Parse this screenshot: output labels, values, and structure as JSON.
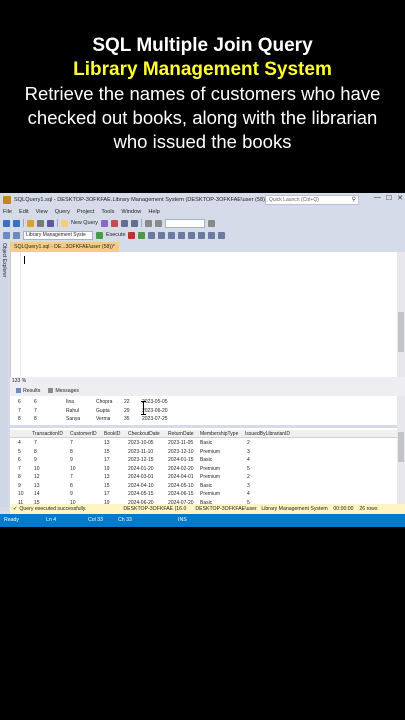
{
  "caption": {
    "title": "SQL Multiple Join Query",
    "subtitle": "Library Management System",
    "description": "Retrieve the names of customers who have checked out books, along with the librarian who issued the books"
  },
  "window": {
    "title": "SQLQuery1.sql - DESKTOP-3OFKFAE.Library Management System (DESKTOP-3OFKFAE\\user (58))* - ...",
    "quick_launch_placeholder": "Quick Launch (Ctrl+Q)",
    "controls": {
      "minimize": "—",
      "restore": "☐",
      "close": "✕"
    }
  },
  "menu": [
    "File",
    "Edit",
    "View",
    "Query",
    "Project",
    "Tools",
    "Window",
    "Help"
  ],
  "toolbar": {
    "new_query": "New Query",
    "database": "Library Management Syste",
    "execute": "Execute"
  },
  "side_label": "Object Explorer",
  "doc_tab": "SQLQuery1.sql - DE...3OFKFAE\\user (58))*",
  "zoom": "133 %",
  "result_tabs": {
    "results": "Results",
    "messages": "Messages"
  },
  "grid1": {
    "rows": [
      [
        "6",
        "6",
        "Iina",
        "Chopra",
        "22",
        "2023-05-05"
      ],
      [
        "7",
        "7",
        "Rahul",
        "Gupta",
        "29",
        "2023-06-20"
      ],
      [
        "8",
        "8",
        "Sanya",
        "Verma",
        "35",
        "2023-07-25"
      ]
    ]
  },
  "grid2": {
    "columns": [
      "TransactionID",
      "CustomerID",
      "BookID",
      "CheckoutDate",
      "ReturnDate",
      "MembershipType",
      "IssuedByLibrarianID"
    ],
    "rows": [
      [
        "4",
        "7",
        "7",
        "13",
        "2023-10-05",
        "2023-11-05",
        "Basic",
        "2"
      ],
      [
        "5",
        "8",
        "8",
        "15",
        "2023-11-10",
        "2023-12-10",
        "Premium",
        "3"
      ],
      [
        "6",
        "9",
        "9",
        "17",
        "2023-12-15",
        "2024-01-15",
        "Basic",
        "4"
      ],
      [
        "7",
        "10",
        "10",
        "19",
        "2024-01-20",
        "2024-02-20",
        "Premium",
        "5"
      ],
      [
        "8",
        "12",
        "7",
        "13",
        "2024-03-01",
        "2024-04-01",
        "Premium",
        "2"
      ],
      [
        "9",
        "13",
        "8",
        "15",
        "2024-04-10",
        "2024-05-10",
        "Basic",
        "3"
      ],
      [
        "10",
        "14",
        "9",
        "17",
        "2024-05-15",
        "2024-06-15",
        "Premium",
        "4"
      ],
      [
        "11",
        "15",
        "10",
        "19",
        "2024-06-20",
        "2024-07-20",
        "Basic",
        "5"
      ]
    ]
  },
  "status": {
    "message": "Query executed successfully.",
    "server": "DESKTOP-3OFKFAE (16.0 RTM)",
    "user": "DESKTOP-3OFKFAE\\user (58)",
    "database": "Library Management System",
    "time": "00:00:00",
    "rows": "26 rows"
  },
  "ready": {
    "state": "Ready",
    "ln": "Ln 4",
    "col": "Col 33",
    "ch": "Ch 33",
    "mode": "INS"
  },
  "colors": {
    "accent": "#007acc",
    "tab": "#f5cc84",
    "subtitle": "#ffff33"
  }
}
